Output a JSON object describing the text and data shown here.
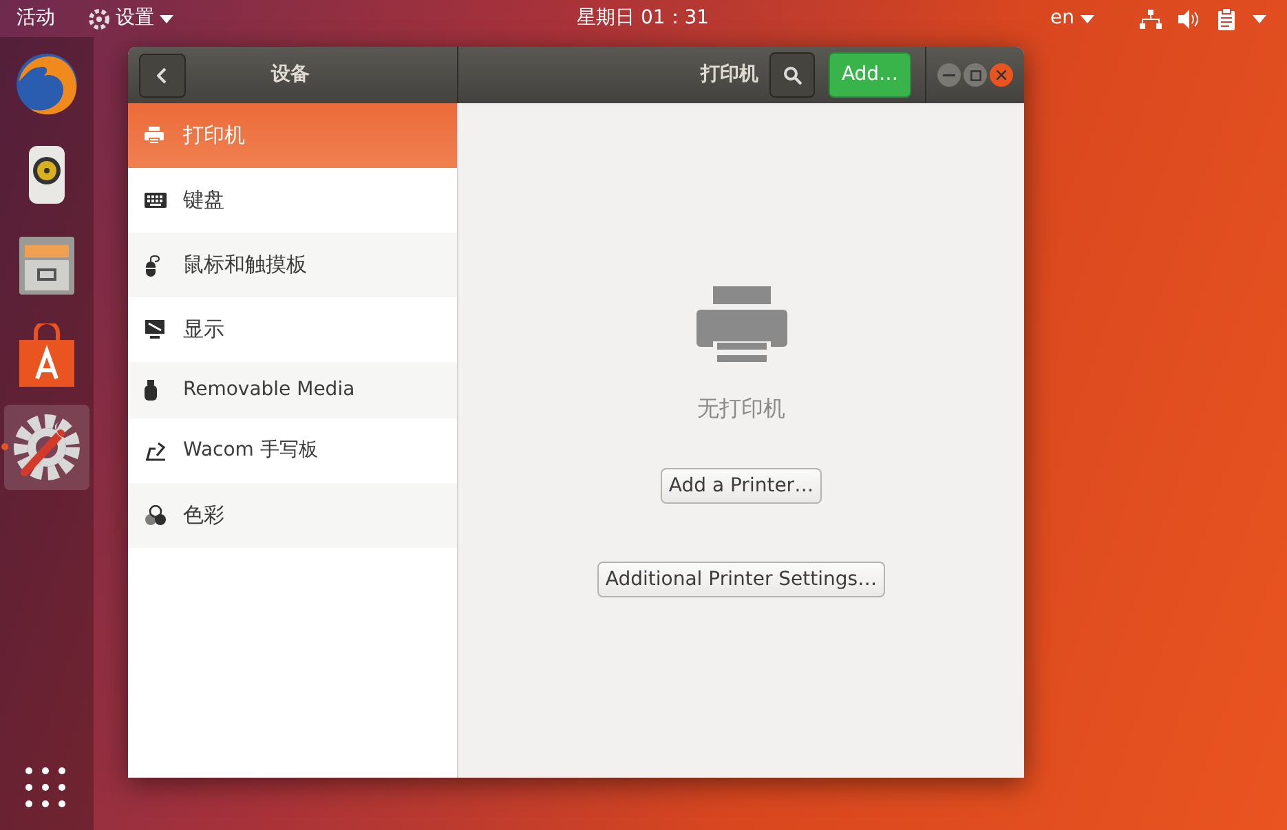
{
  "top_bar": {
    "activities": "活动",
    "app_menu": "设置",
    "clock": "星期日 01：31",
    "language": "en"
  },
  "dock": {
    "items": [
      {
        "kind": "browser",
        "selected": false
      },
      {
        "kind": "speaker",
        "selected": false
      },
      {
        "kind": "files",
        "selected": false
      },
      {
        "kind": "store",
        "selected": false
      },
      {
        "kind": "settings",
        "selected": true
      }
    ]
  },
  "window": {
    "sidebar_title": "设备",
    "page_title": "打印机",
    "add_button": "Add…"
  },
  "sidebar": {
    "items": [
      {
        "kind": "printer",
        "label": "打印机",
        "selected": true
      },
      {
        "kind": "keyboard",
        "label": "键盘",
        "selected": false
      },
      {
        "kind": "mouse",
        "label": "鼠标和触摸板",
        "selected": false
      },
      {
        "kind": "display",
        "label": "显示",
        "selected": false
      },
      {
        "kind": "usb",
        "label": "Removable Media",
        "selected": false
      },
      {
        "kind": "tablet",
        "label": "Wacom 手写板",
        "selected": false
      },
      {
        "kind": "color",
        "label": "色彩",
        "selected": false
      }
    ]
  },
  "content": {
    "empty_message": "无打印机",
    "buttons": [
      "Add a Printer…",
      "Additional Printer Settings…"
    ]
  }
}
